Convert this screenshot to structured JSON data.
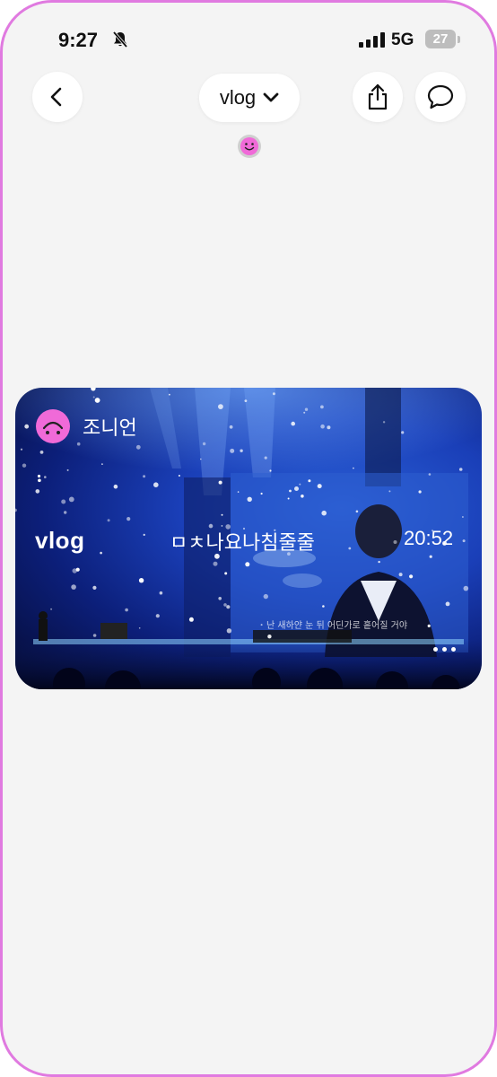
{
  "status_bar": {
    "time": "9:27",
    "network": "5G",
    "battery": "27"
  },
  "header": {
    "title": "vlog"
  },
  "card": {
    "author": "조니언",
    "category": "vlog",
    "title": "ㅁㅊ나요나침줄줄",
    "duration": "20:52",
    "screen_lyric": "난 새하얀 눈 뒤 어딘가로 흩어질 거야"
  },
  "colors": {
    "frame": "#e07ae0",
    "avatar": "#f06ad8",
    "card_blue": "#1a3fb8"
  },
  "icons": [
    "bell-slash-icon",
    "back-chevron-icon",
    "chevron-down-icon",
    "share-icon",
    "chat-bubble-icon",
    "smiley-icon",
    "more-icon"
  ]
}
